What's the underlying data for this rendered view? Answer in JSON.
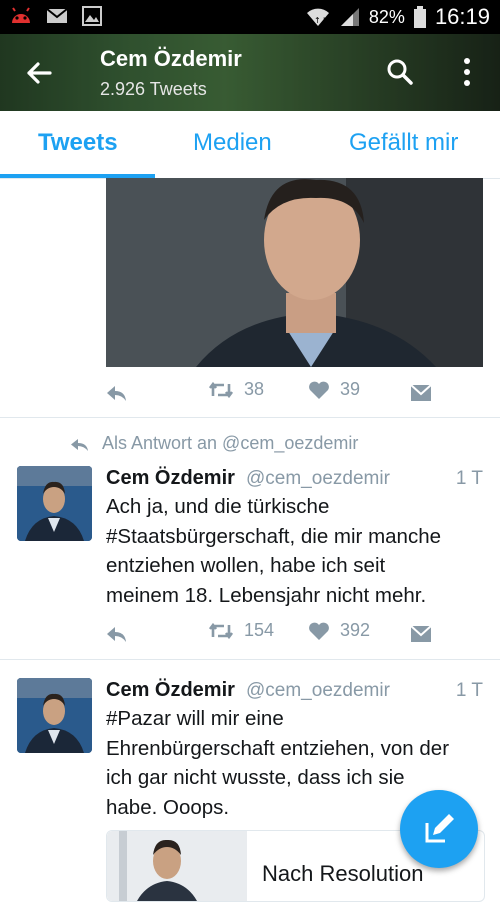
{
  "status_bar": {
    "battery": "82%",
    "time": "16:19"
  },
  "header": {
    "title": "Cem Özdemir",
    "subtitle": "2.926 Tweets"
  },
  "tabs": [
    {
      "label": "Tweets"
    },
    {
      "label": "Medien"
    },
    {
      "label": "Gefällt mir"
    }
  ],
  "tweet1": {
    "retweets": "38",
    "likes": "39"
  },
  "tweet2": {
    "reply_context": "Als Antwort an @cem_oezdemir",
    "name": "Cem Özdemir",
    "handle": "@cem_oezdemir",
    "time": "1 T",
    "lines": [
      "Ach ja, und die türkische",
      "#Staatsbürgerschaft, die mir manche",
      "entziehen wollen, habe ich seit",
      "meinem 18. Lebensjahr nicht mehr."
    ],
    "retweets": "154",
    "likes": "392"
  },
  "tweet3": {
    "name": "Cem Özdemir",
    "handle": "@cem_oezdemir",
    "time": "1 T",
    "lines": [
      "#Pazar will mir eine",
      "Ehrenbürgerschaft entziehen, von der",
      "ich gar nicht wusste, dass ich sie",
      "habe. Ooops."
    ],
    "card_title": "Nach Resolution"
  },
  "colors": {
    "accent": "#1da1f2",
    "muted": "#8899a6",
    "text": "#14171a"
  }
}
